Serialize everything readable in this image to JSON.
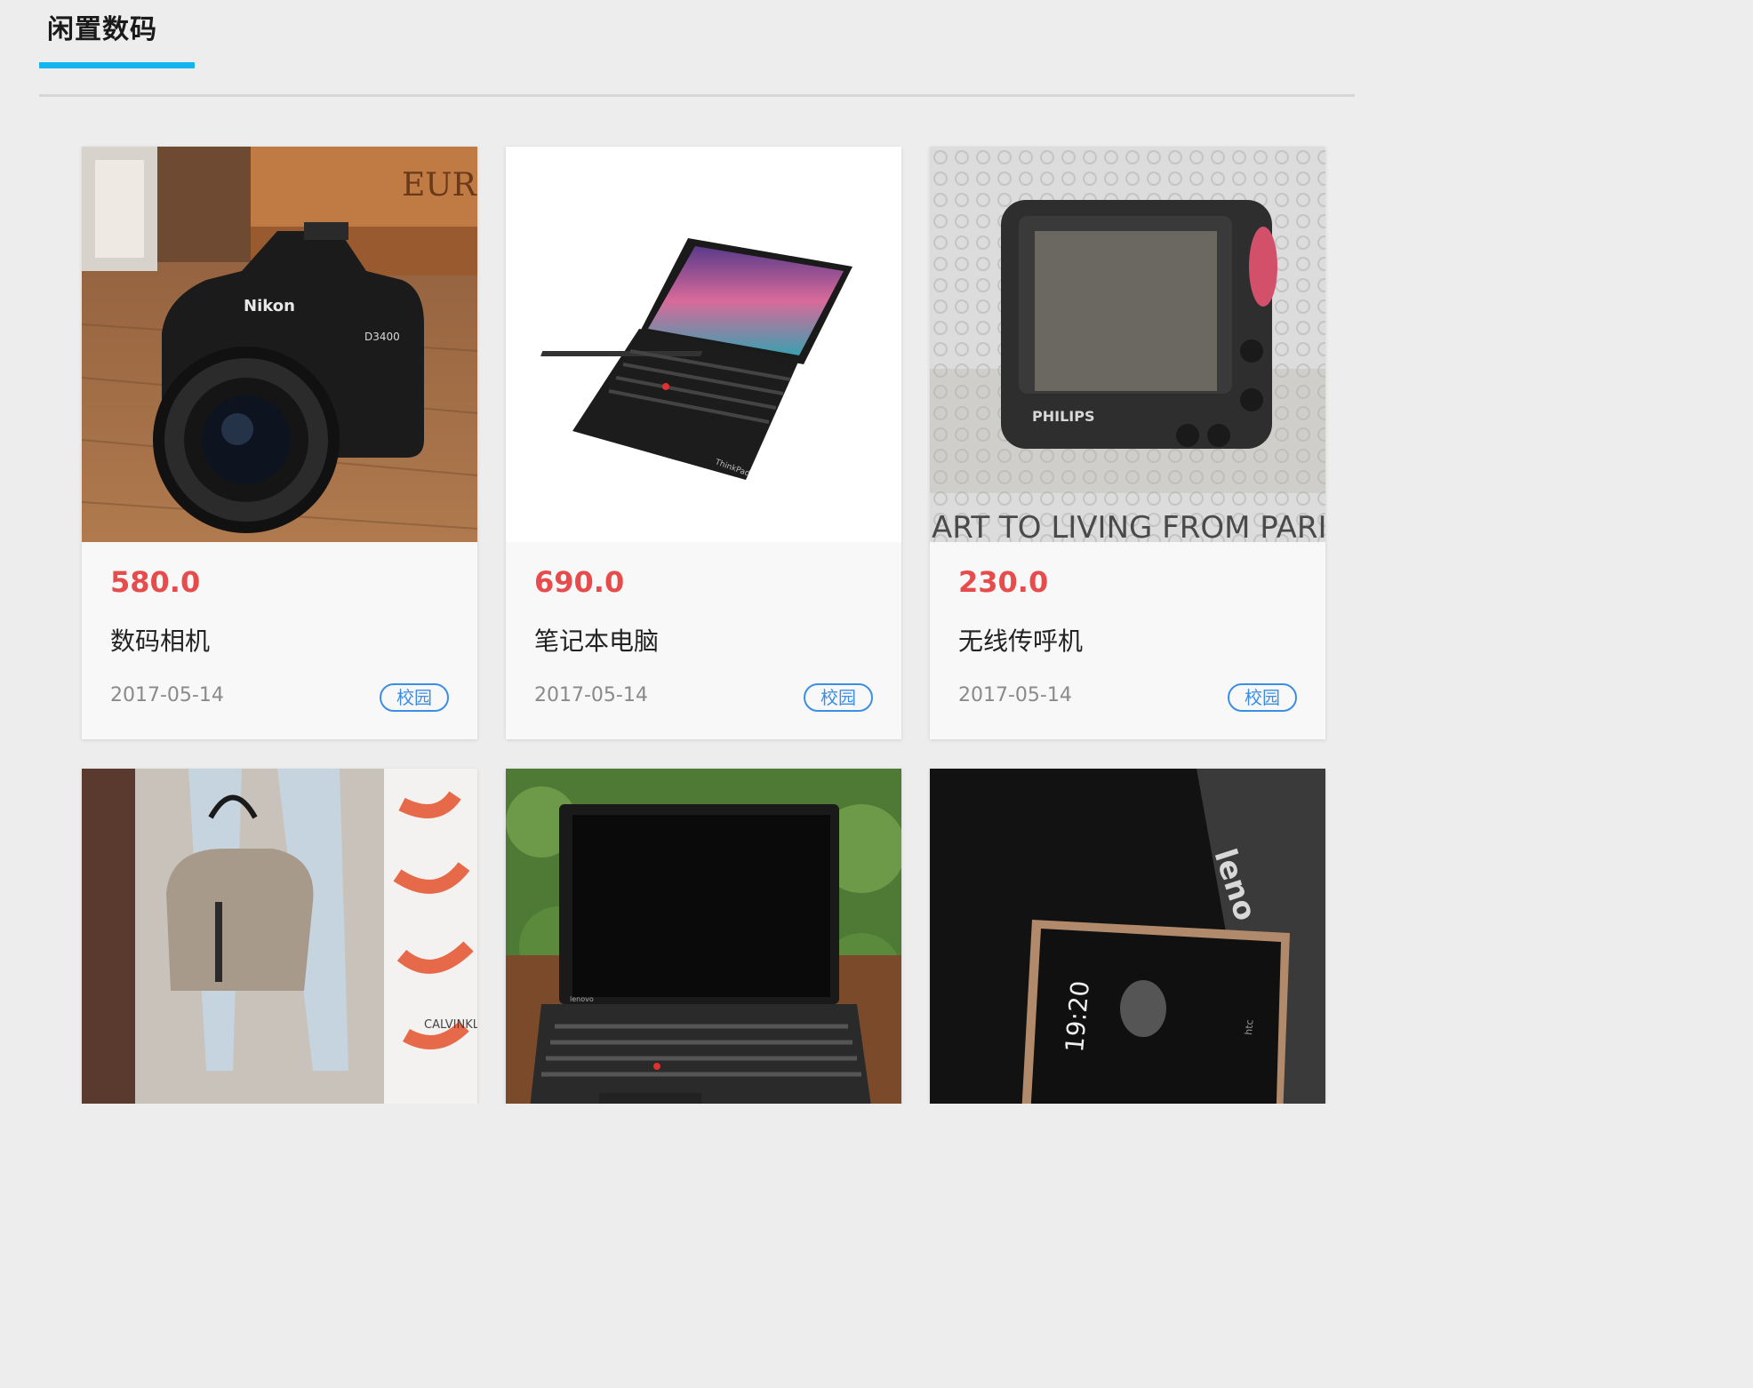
{
  "section": {
    "title": "闲置数码"
  },
  "items": [
    {
      "price": "580.0",
      "name": "数码相机",
      "date": "2017-05-14",
      "tag": "校园",
      "image": "camera-photo"
    },
    {
      "price": "690.0",
      "name": "笔记本电脑",
      "date": "2017-05-14",
      "tag": "校园",
      "image": "laptop-photo"
    },
    {
      "price": "230.0",
      "name": "无线传呼机",
      "date": "2017-05-14",
      "tag": "校园",
      "image": "pager-photo"
    },
    {
      "image": "handbag-photo"
    },
    {
      "image": "laptop-outdoor-photo"
    },
    {
      "image": "smartphone-photo"
    }
  ],
  "colors": {
    "accent": "#13b5ee",
    "price": "#e74c4c",
    "tag": "#3a8ee6",
    "background": "#ededed"
  },
  "photo_text": {
    "camera_brand": "Nikon",
    "camera_model": "D3400",
    "books": "EURO",
    "pager_brand": "PHILIPS",
    "pager_bg_text": "ART TO LIVING FROM PARIS",
    "store_text": "CALVINKL",
    "laptop_brand": "lenovo",
    "laptop_logo": "ThinkPad",
    "phone_time": "19:20",
    "phone_brand": "htc",
    "lenovo_lid": "leno"
  }
}
